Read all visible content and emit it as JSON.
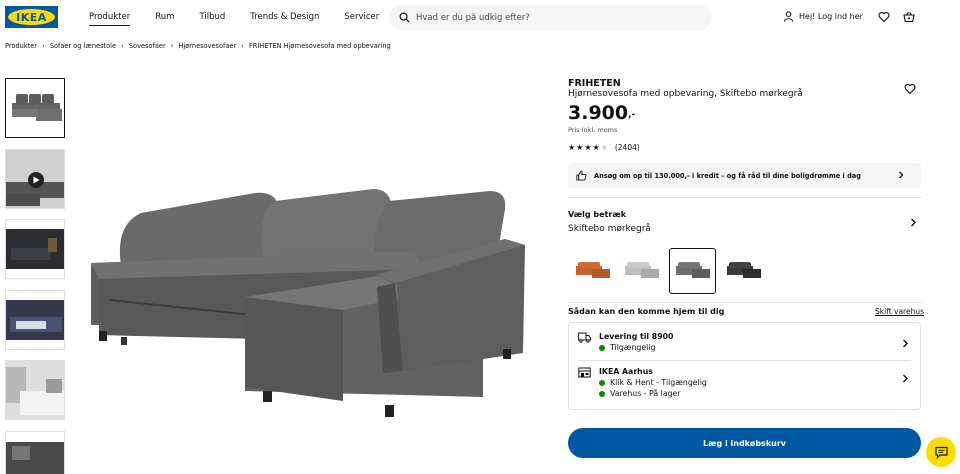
{
  "header": {
    "logo": "IKEA",
    "nav": [
      "Produkter",
      "Rum",
      "Tilbud",
      "Trends & Design",
      "Servicer"
    ],
    "search_placeholder": "Hvad er du på udkig efter?",
    "login_label": "Hej! Log ind her"
  },
  "breadcrumb": [
    "Produkter",
    "Sofaer og lænestole",
    "Sovesofaer",
    "Hjørnesovesofaer",
    "FRIHETEN Hjørnesovesofa med opbevaring"
  ],
  "product": {
    "name": "FRIHETEN",
    "description": "Hjørnesovesofa med opbevaring, Skiftebo mørkegrå",
    "price": "3.900",
    "price_suffix": ",-",
    "vat_note": "Pris inkl. moms",
    "rating_stars": 4,
    "review_count": "(2404)"
  },
  "credit_banner": "Ansøg om op til 130.000,- i kredit – og få råd til dine boligdrømme i dag",
  "cover": {
    "title": "Vælg betræk",
    "selected": "Skiftebo mørkegrå",
    "swatch_colors": [
      "#c4642a",
      "#bdbdbd",
      "#6d6d6d",
      "#3a3a3a"
    ]
  },
  "delivery": {
    "title": "Sådan kan den komme hjem til dig",
    "change_store": "Skift varehus",
    "rows": [
      {
        "label": "Levering til 8900",
        "statuses": [
          "Tilgængelig"
        ]
      },
      {
        "label": "IKEA Aarhus",
        "statuses": [
          "Klik & Hent - Tilgængelig",
          "Varehus - På lager"
        ]
      }
    ]
  },
  "cart_button": "Læg i indkøbskurv",
  "colors": {
    "brand_blue": "#0058a3",
    "brand_yellow": "#ffdb00",
    "available_green": "#0a8a00"
  }
}
